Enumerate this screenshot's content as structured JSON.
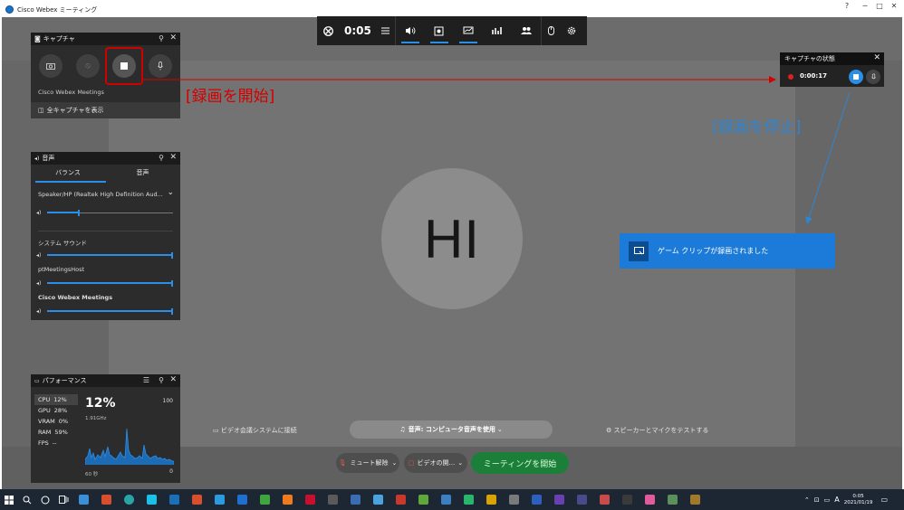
{
  "window": {
    "title": "Cisco Webex ミーティング",
    "controls": [
      "?",
      "─",
      "□",
      "✕"
    ]
  },
  "avatar": {
    "initials": "HI"
  },
  "gamebar": {
    "time": "0:05"
  },
  "capture_panel": {
    "title": "キャプチャ",
    "source": "Cisco Webex Meetings",
    "show_all": "全キャプチャを表示"
  },
  "audio_panel": {
    "title": "音声",
    "tabs": [
      "バランス",
      "音声"
    ],
    "device": "Speaker/HP (Realtek High Definition Aud...",
    "device_level": 0.25,
    "apps": [
      {
        "name": "システム サウンド",
        "level": 1.0
      },
      {
        "name": "ptMeetingsHost",
        "level": 1.0
      },
      {
        "name": "Cisco Webex Meetings",
        "level": 1.0
      }
    ]
  },
  "perf_panel": {
    "title": "パフォーマンス",
    "stats": [
      {
        "label": "CPU",
        "value": "12%"
      },
      {
        "label": "GPU",
        "value": "28%"
      },
      {
        "label": "VRAM",
        "value": "0%"
      },
      {
        "label": "RAM",
        "value": "59%"
      },
      {
        "label": "FPS",
        "value": "--"
      }
    ],
    "big_value": "12%",
    "freq": "1.91GHz",
    "max": "100",
    "min": "0",
    "duration": "60 秒"
  },
  "status_panel": {
    "title": "キャプチャの状態",
    "elapsed": "0:00:17"
  },
  "annotations": {
    "start": "[録画を開始]",
    "stop": "[録画を停止]"
  },
  "toast": {
    "message": "ゲーム クリップが録画されました"
  },
  "meeting_bar": {
    "video_system": "ビデオ会議システムに接続",
    "audio": "音声: コンピュータ音声を使用",
    "test": "スピーカーとマイクをテストする",
    "mute": "ミュート解除",
    "video": "ビデオの開...",
    "start": "ミーティングを開始"
  },
  "taskbar": {
    "time": "0:05",
    "date": "2021/01/19",
    "ime": "A"
  },
  "colors": {
    "accent_blue": "#2b8fe6",
    "toast_blue": "#1c7bd8",
    "start_green": "#1b7f3a",
    "annotation_red": "#d40000"
  }
}
